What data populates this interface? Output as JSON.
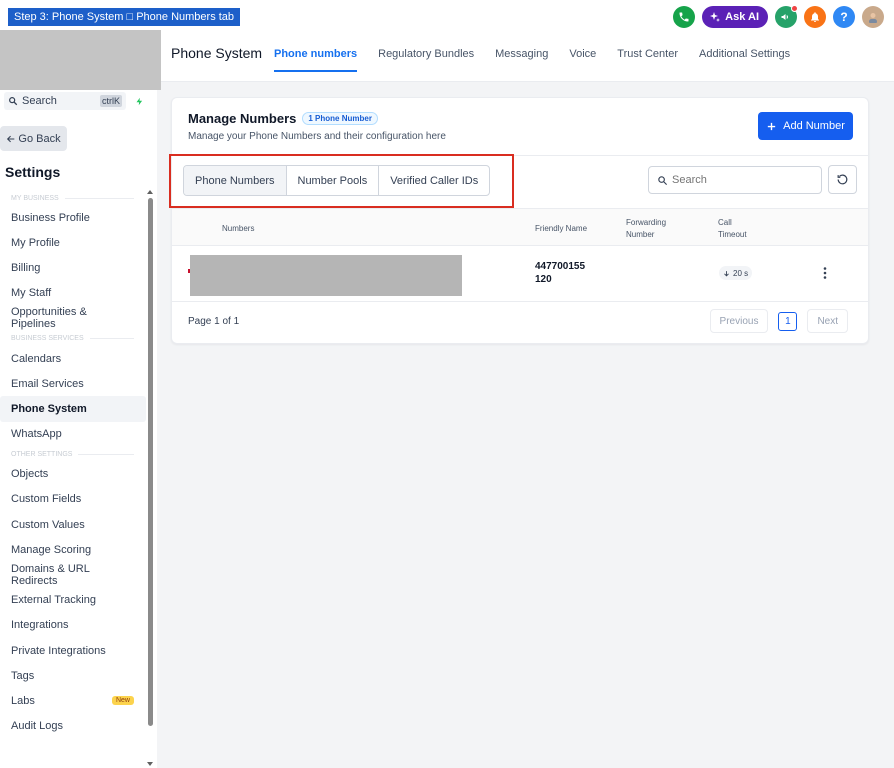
{
  "banner": {
    "text": "Step 3: Phone System □ Phone Numbers tab"
  },
  "topbar": {
    "ask_ai": "Ask AI",
    "help": "?"
  },
  "sidebar": {
    "search_label": "Search",
    "search_shortcut": "ctrlK",
    "go_back": "Go Back",
    "title": "Settings",
    "sections": [
      {
        "heading": "MY BUSINESS",
        "items": [
          "Business Profile",
          "My Profile",
          "Billing",
          "My Staff",
          "Opportunities & Pipelines"
        ]
      },
      {
        "heading": "BUSINESS SERVICES",
        "items": [
          "Calendars",
          "Email Services",
          "Phone System",
          "WhatsApp"
        ]
      },
      {
        "heading": "OTHER SETTINGS",
        "items": [
          "Objects",
          "Custom Fields",
          "Custom Values",
          "Manage Scoring",
          "Domains & URL Redirects",
          "External Tracking",
          "Integrations",
          "Private Integrations",
          "Tags",
          "Labs",
          "Audit Logs"
        ]
      }
    ],
    "active_item": "Phone System",
    "labs_badge": "New"
  },
  "header": {
    "title": "Phone System",
    "tabs": [
      "Phone numbers",
      "Regulatory Bundles",
      "Messaging",
      "Voice",
      "Trust Center",
      "Additional Settings"
    ],
    "active_tab": "Phone numbers"
  },
  "card": {
    "title": "Manage Numbers",
    "count_badge": "1 Phone Number",
    "subtitle": "Manage your Phone Numbers and their configuration here",
    "add_button": "Add Number",
    "segments": [
      "Phone Numbers",
      "Number Pools",
      "Verified Caller IDs"
    ],
    "active_segment": "Phone Numbers",
    "search_placeholder": "Search",
    "columns": {
      "numbers": "Numbers",
      "friendly": "Friendly Name",
      "forwarding": "Forwarding Number",
      "timeout": "Call Timeout"
    },
    "rows": [
      {
        "friendly_name": "447700155 120",
        "forwarding": "",
        "timeout": "20 s"
      }
    ],
    "pager": {
      "text": "Page 1 of 1",
      "previous": "Previous",
      "page": "1",
      "next": "Next"
    }
  },
  "icons": [
    "phone-icon",
    "sparkle-icon",
    "megaphone-icon",
    "bell-icon",
    "help-icon",
    "avatar",
    "search-icon",
    "bolt-icon",
    "arrow-left-icon",
    "plus-icon",
    "refresh-icon",
    "kebab-icon",
    "arrow-down-icon"
  ],
  "colors": {
    "accent": "#155eef",
    "active_tab": "#1570ef",
    "highlight": "#d92d20",
    "ask_ai": "#5b21b6",
    "banner": "#1d5fc9"
  }
}
